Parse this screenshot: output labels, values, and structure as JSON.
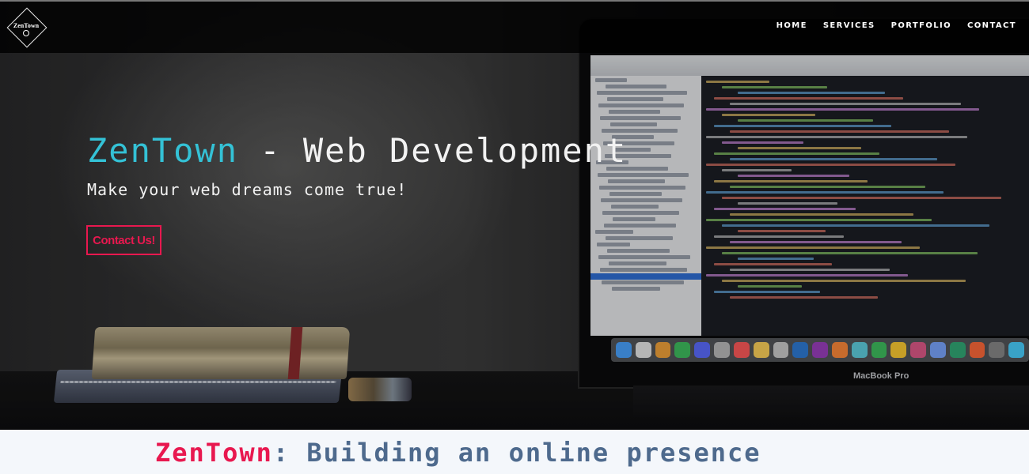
{
  "header": {
    "logo_text": "ZenTown",
    "nav": [
      "HOME",
      "SERVICES",
      "PORTFOLIO",
      "CONTACT"
    ]
  },
  "hero": {
    "title_brand": "ZenTown",
    "title_rest": " - Web Development",
    "subtitle": "Make your web dreams come true!",
    "cta_label": "Contact Us!",
    "laptop_label": "MacBook Pro"
  },
  "section": {
    "title_brand": "ZenTown",
    "title_rest": ": Building an online presence"
  },
  "colors": {
    "accent_cyan": "#34c2d6",
    "accent_red": "#e8184f",
    "section_blue": "#4e6a8d"
  }
}
